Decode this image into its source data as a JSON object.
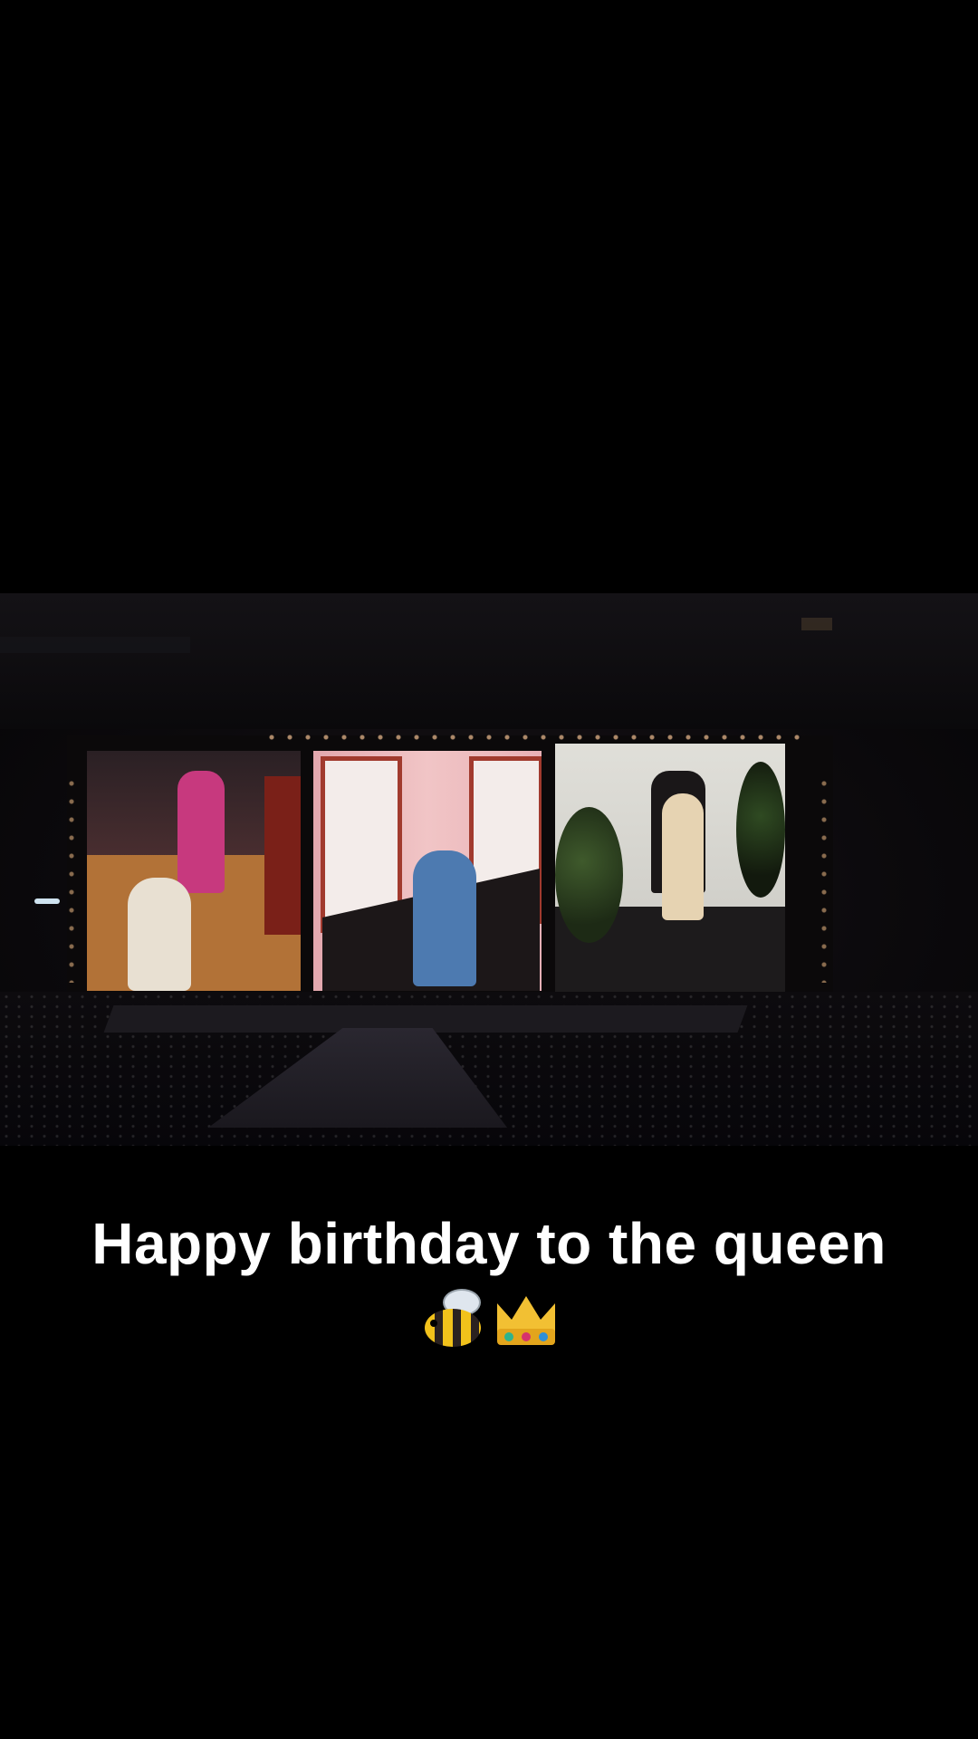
{
  "caption": {
    "text": "Happy birthday to the queen",
    "emojis": [
      "bee-icon",
      "crown-icon"
    ]
  },
  "colors": {
    "background": "#000000",
    "caption_text": "#ffffff"
  }
}
